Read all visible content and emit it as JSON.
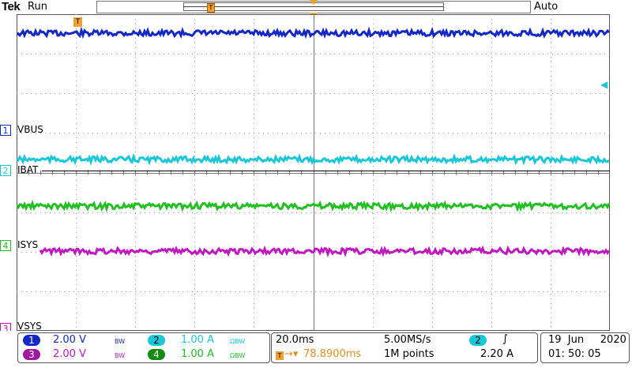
{
  "header": {
    "brand": "Tek",
    "state": "Run",
    "trigger_mode": "Auto",
    "record_marker": "T"
  },
  "waveform": {
    "position_marker": "T",
    "channels": [
      {
        "num": "1",
        "name": "VBUS",
        "color": "#1428c8"
      },
      {
        "num": "2",
        "name": "IBAT",
        "color": "#18c8d8"
      },
      {
        "num": "4",
        "name": "ISYS",
        "color": "#20c020"
      },
      {
        "num": "3",
        "name": "VSYS",
        "color": "#c018c0"
      }
    ]
  },
  "status": {
    "ch1": {
      "num": "1",
      "scale": "2.00 V",
      "bw": "BW"
    },
    "ch3": {
      "num": "3",
      "scale": "2.00 V",
      "bw": "BW"
    },
    "ch2": {
      "num": "2",
      "scale": "1.00 A",
      "bw": "ΩBW"
    },
    "ch4": {
      "num": "4",
      "scale": "1.00 A",
      "bw": "ΩBW"
    },
    "timebase": "20.0ms",
    "sample_rate": "5.00MS/s",
    "delay": "78.8900ms",
    "record_length": "1M points",
    "trigger_source": "2",
    "trigger_slope": "∫",
    "trigger_level": "2.20 A",
    "date": "19  Jun     2020",
    "time": "01: 50: 05"
  }
}
